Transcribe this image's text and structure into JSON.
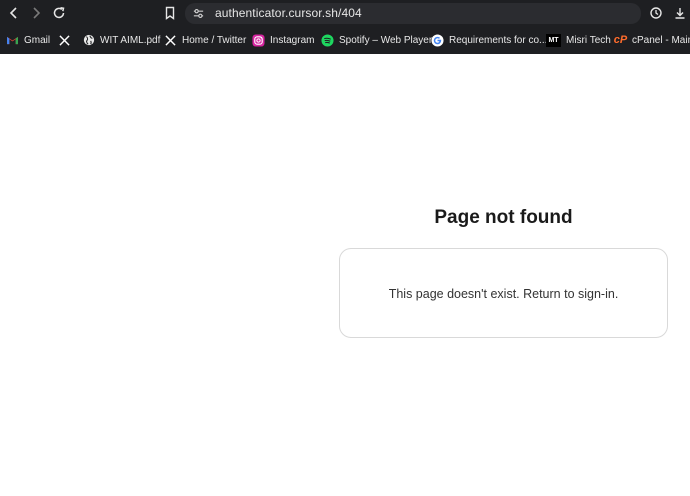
{
  "browser": {
    "url": "authenticator.cursor.sh/404"
  },
  "bookmarks": [
    {
      "label": "Gmail",
      "icon": "gmail-icon"
    },
    {
      "label": "",
      "icon": "x-icon"
    },
    {
      "label": "WIT AIML.pdf",
      "icon": "globe-icon"
    },
    {
      "label": "Home / Twitter",
      "icon": "x-icon"
    },
    {
      "label": "Instagram",
      "icon": "instagram-icon"
    },
    {
      "label": "Spotify – Web Player",
      "icon": "spotify-icon"
    },
    {
      "label": "Requirements for co...",
      "icon": "google-icon"
    },
    {
      "label": "Misri Tech",
      "icon": "mt-icon"
    },
    {
      "label": "cPanel - Main",
      "icon": "cpanel-icon"
    }
  ],
  "page": {
    "title": "Page not found",
    "message_prefix": "This page doesn't exist. ",
    "return_link": "Return to sign-in."
  },
  "colors": {
    "browser_chrome": "#1e1f22",
    "urlbar": "#2b2c30",
    "card_border": "#d9d9d9",
    "title_text": "#1a1a1a"
  }
}
